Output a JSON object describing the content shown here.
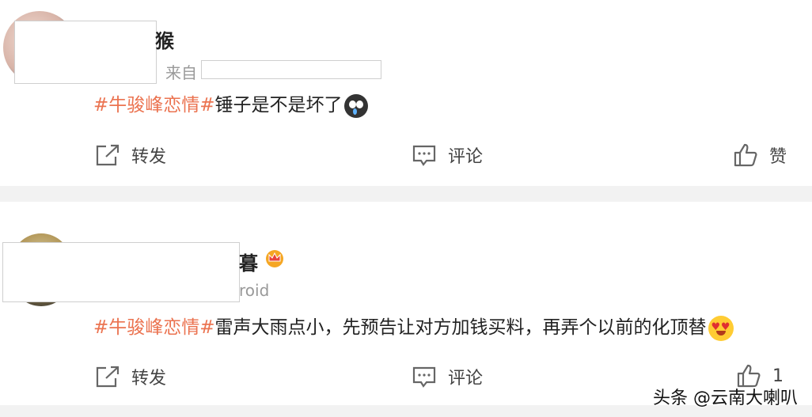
{
  "posts": [
    {
      "nickname_visible": "猴",
      "source_prefix": "来自",
      "hashtag": "#牛骏峰恋情#",
      "text": "锤子是不是坏了",
      "emoji": "cry-icon",
      "actions": {
        "repost": "转发",
        "comment": "评论",
        "like": "赞"
      }
    },
    {
      "nickname_visible": "暮",
      "source_visible": "roid",
      "badge": "crown-icon",
      "hashtag": "#牛骏峰恋情#",
      "text": "雷声大雨点小，先预告让对方加钱买料，再弄个以前的化顶替",
      "emoji": "heart-eyes-icon",
      "actions": {
        "repost": "转发",
        "comment": "评论",
        "like_count": "1"
      }
    }
  ],
  "watermark": "头条 @云南大喇叭",
  "colors": {
    "hashtag": "#eb7350",
    "divider": "#f2f2f2"
  }
}
